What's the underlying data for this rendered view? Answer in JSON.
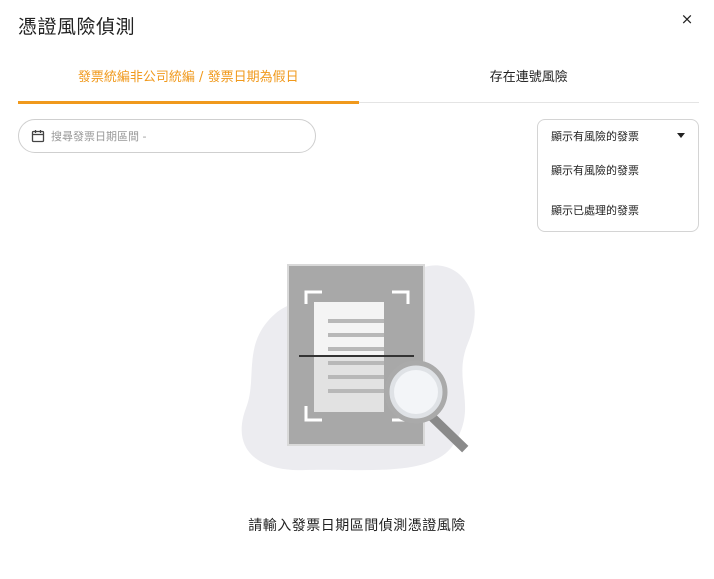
{
  "dialog": {
    "title": "憑證風險偵測",
    "close_label": "×"
  },
  "tabs": [
    {
      "label": "發票統編非公司統編 / 發票日期為假日",
      "active": true
    },
    {
      "label": "存在連號風險",
      "active": false
    }
  ],
  "search": {
    "placeholder": "搜尋發票日期區間 -",
    "value": ""
  },
  "filter": {
    "selected": "顯示有風險的發票",
    "options": [
      "顯示有風險的發票",
      "顯示已處理的發票"
    ]
  },
  "empty_state": {
    "message": "請輸入發票日期區間偵測憑證風險"
  },
  "colors": {
    "accent": "#f0991c",
    "text": "#222222",
    "border": "#d4d4d4"
  },
  "icons": {
    "search_field": "calendar-icon",
    "dialog_close": "close-icon",
    "filter": "caret-down-icon"
  }
}
